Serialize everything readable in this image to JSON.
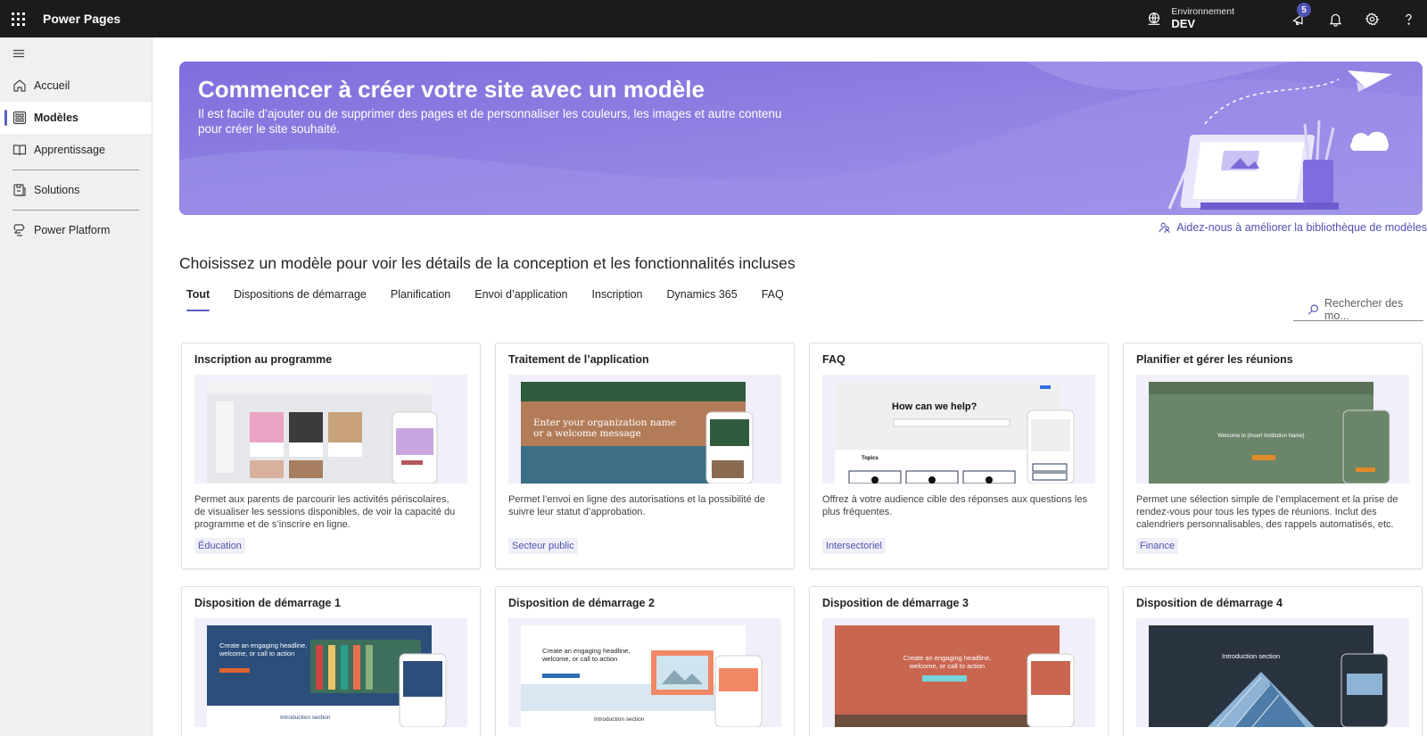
{
  "app": {
    "title": "Power Pages"
  },
  "environment": {
    "label": "Environnement",
    "value": "DEV"
  },
  "notifications": {
    "badge_count": "5"
  },
  "sidebar": {
    "items": [
      {
        "label": "Accueil",
        "icon": "home-icon"
      },
      {
        "label": "Modèles",
        "icon": "templates-icon",
        "active": true
      },
      {
        "label": "Apprentissage",
        "icon": "book-icon"
      },
      {
        "label": "Solutions",
        "icon": "solutions-icon"
      },
      {
        "label": "Power Platform",
        "icon": "power-platform-icon"
      }
    ]
  },
  "banner": {
    "title": "Commencer à créer votre site avec un modèle",
    "subtitle": "Il est facile d’ajouter ou de supprimer des pages et de personnaliser les couleurs, les images et autre contenu pour créer le site souhaité."
  },
  "improve_link": "Aidez-nous à améliorer la bibliothèque de modèles",
  "section_title": "Choisissez un modèle pour voir les détails de la conception et les fonctionnalités incluses",
  "tabs": [
    {
      "label": "Tout",
      "active": true
    },
    {
      "label": "Dispositions de démarrage"
    },
    {
      "label": "Planification"
    },
    {
      "label": "Envoi d’application"
    },
    {
      "label": "Inscription"
    },
    {
      "label": "Dynamics 365"
    },
    {
      "label": "FAQ"
    }
  ],
  "search": {
    "placeholder": "Rechercher des mo..."
  },
  "cards": [
    {
      "title": "Inscription au programme",
      "desc": "Permet aux parents de parcourir les activités périscolaires, de visualiser les sessions disponibles, de voir la capacité du programme et de s’inscrire en ligne.",
      "tag": "Éducation"
    },
    {
      "title": "Traitement de l’application",
      "desc": "Permet l’envoi en ligne des autorisations et la possibilité de suivre leur statut d’approbation.",
      "tag": "Secteur public",
      "thumb_text": "Enter your organization name or a welcome message"
    },
    {
      "title": "FAQ",
      "desc": "Offrez à votre audience cible des réponses aux questions les plus fréquentes.",
      "tag": "Intersectoriel",
      "thumb_text": "How can we help?",
      "thumb_sub": "Topics"
    },
    {
      "title": "Planifier et gérer les réunions",
      "desc": "Permet une sélection simple de l’emplacement et la prise de rendez-vous pour tous les types de réunions. Inclut des calendriers personnalisables, des rappels automatisés, etc.",
      "tag": "Finance",
      "thumb_text": "Welcome to {Insert Institution Name}"
    },
    {
      "title": "Disposition de démarrage 1",
      "thumb_text": "Create an engaging headline, welcome, or call to action",
      "thumb_sub": "Introduction section"
    },
    {
      "title": "Disposition de démarrage 2",
      "thumb_text": "Create an engaging headline, welcome, or call to action",
      "thumb_sub": "Introduction section"
    },
    {
      "title": "Disposition de démarrage 3",
      "thumb_text": "Create an engaging headline, welcome, or call to action"
    },
    {
      "title": "Disposition de démarrage 4",
      "thumb_text": "Introduction section"
    }
  ],
  "colors": {
    "accent": "#5b5fc7",
    "topbar": "#1b1b1b",
    "banner": "#8c7de2",
    "link": "#4f52b2"
  }
}
